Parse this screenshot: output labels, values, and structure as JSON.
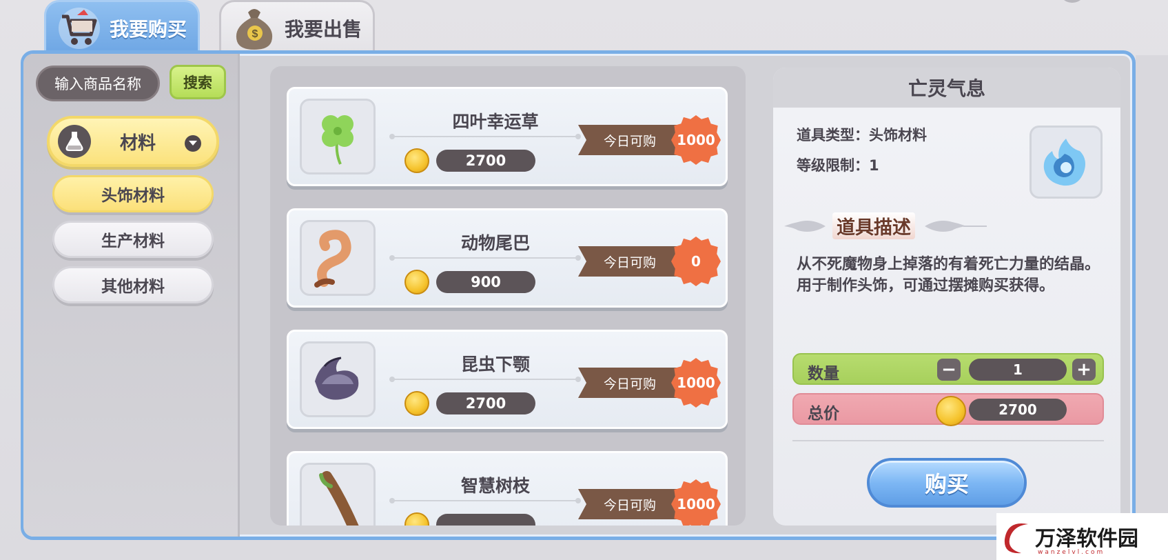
{
  "tabs": {
    "buy_label": "我要购买",
    "sell_label": "我要出售"
  },
  "search": {
    "placeholder": "输入商品名称",
    "button_label": "搜索"
  },
  "category": {
    "main_label": "材料",
    "sub_items": [
      {
        "label": "头饰材料",
        "active": true
      },
      {
        "label": "生产材料",
        "active": false
      },
      {
        "label": "其他材料",
        "active": false
      }
    ]
  },
  "items": [
    {
      "name": "四叶幸运草",
      "price": "2700",
      "limit_label": "今日可购",
      "limit": "1000",
      "icon": "clover-icon"
    },
    {
      "name": "动物尾巴",
      "price": "900",
      "limit_label": "今日可购",
      "limit": "0",
      "icon": "tail-icon"
    },
    {
      "name": "昆虫下颚",
      "price": "2700",
      "limit_label": "今日可购",
      "limit": "1000",
      "icon": "mandible-icon"
    },
    {
      "name": "智慧树枝",
      "price": "",
      "limit_label": "今日可购",
      "limit": "1000",
      "icon": "branch-icon"
    }
  ],
  "detail": {
    "title": "亡灵气息",
    "type_line": "道具类型：头饰材料",
    "level_line": "等级限制：1",
    "desc_title": "道具描述",
    "description": "从不死魔物身上掉落的有着死亡力量的结晶。用于制作头饰，可通过摆摊购买获得。",
    "quantity_label": "数量",
    "quantity": "1",
    "minus": "−",
    "plus": "+",
    "total_label": "总价",
    "total": "2700",
    "buy_label": "购买",
    "icon": "spirit-flame-icon"
  },
  "watermark": {
    "text": "万泽软件园",
    "url": "wanzelvl.com"
  },
  "colors": {
    "accent_blue": "#79aee6",
    "active_yellow": "#fbe07a",
    "badge_orange": "#ef7043",
    "ribbon_brown": "#7a5846",
    "qty_green": "#a7d05c",
    "total_pink": "#ea99a3"
  }
}
